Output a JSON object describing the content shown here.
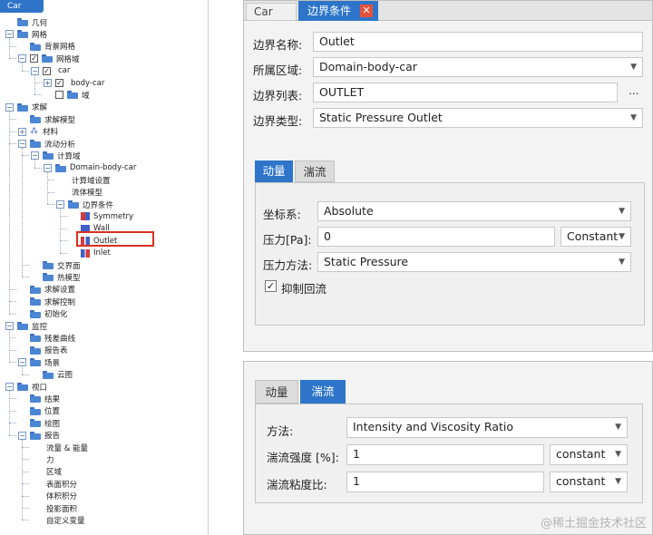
{
  "left_panel": {
    "tab_label": "Car",
    "tree": [
      {
        "label": "几何",
        "icon": "folder",
        "indent": 0,
        "expander": ""
      },
      {
        "label": "网格",
        "icon": "folder",
        "indent": 0,
        "expander": "−"
      },
      {
        "label": "背景网格",
        "icon": "folder",
        "indent": 1,
        "expander": ""
      },
      {
        "label": "网格域",
        "icon": "folder",
        "indent": 1,
        "expander": "−",
        "checked": "✓"
      },
      {
        "label": "car",
        "icon": "none",
        "indent": 2,
        "expander": "−",
        "checked": "✓"
      },
      {
        "label": "body-car",
        "icon": "none",
        "indent": 3,
        "expander": "+",
        "checked": "✓"
      },
      {
        "label": "域",
        "icon": "folder",
        "indent": 3,
        "expander": "",
        "checked": ""
      },
      {
        "label": "求解",
        "icon": "folder",
        "indent": 0,
        "expander": "−"
      },
      {
        "label": "求解模型",
        "icon": "folder",
        "indent": 1,
        "expander": ""
      },
      {
        "label": "材料",
        "icon": "material",
        "indent": 1,
        "expander": "+"
      },
      {
        "label": "流动分析",
        "icon": "folder",
        "indent": 1,
        "expander": "−"
      },
      {
        "label": "计算域",
        "icon": "folder",
        "indent": 2,
        "expander": "−"
      },
      {
        "label": "Domain-body-car",
        "icon": "folder",
        "indent": 3,
        "expander": "−"
      },
      {
        "label": "计算域设置",
        "icon": "none",
        "indent": 4,
        "expander": ""
      },
      {
        "label": "流体模型",
        "icon": "none",
        "indent": 4,
        "expander": ""
      },
      {
        "label": "边界条件",
        "icon": "folder",
        "indent": 4,
        "expander": "−"
      },
      {
        "label": "Symmetry",
        "icon": "boundary-sym",
        "indent": 5,
        "expander": ""
      },
      {
        "label": "Wall",
        "icon": "boundary-wall",
        "indent": 5,
        "expander": ""
      },
      {
        "label": "Outlet",
        "icon": "boundary-outlet",
        "indent": 5,
        "expander": ""
      },
      {
        "label": "Inlet",
        "icon": "boundary-inlet",
        "indent": 5,
        "expander": ""
      },
      {
        "label": "交界面",
        "icon": "folder",
        "indent": 2,
        "expander": ""
      },
      {
        "label": "热模型",
        "icon": "folder",
        "indent": 2,
        "expander": ""
      },
      {
        "label": "求解设置",
        "icon": "folder",
        "indent": 1,
        "expander": ""
      },
      {
        "label": "求解控制",
        "icon": "folder",
        "indent": 1,
        "expander": ""
      },
      {
        "label": "初始化",
        "icon": "folder",
        "indent": 1,
        "expander": ""
      },
      {
        "label": "监控",
        "icon": "folder",
        "indent": 0,
        "expander": "−"
      },
      {
        "label": "残差曲线",
        "icon": "folder",
        "indent": 1,
        "expander": ""
      },
      {
        "label": "报告表",
        "icon": "folder",
        "indent": 1,
        "expander": ""
      },
      {
        "label": "场景",
        "icon": "folder",
        "indent": 1,
        "expander": "−"
      },
      {
        "label": "云图",
        "icon": "folder",
        "indent": 2,
        "expander": ""
      },
      {
        "label": "视口",
        "icon": "folder",
        "indent": 0,
        "expander": "−"
      },
      {
        "label": "结果",
        "icon": "folder",
        "indent": 1,
        "expander": ""
      },
      {
        "label": "位置",
        "icon": "folder",
        "indent": 1,
        "expander": ""
      },
      {
        "label": "绘图",
        "icon": "folder",
        "indent": 1,
        "expander": ""
      },
      {
        "label": "报告",
        "icon": "folder",
        "indent": 1,
        "expander": "−"
      },
      {
        "label": "流量 & 能量",
        "icon": "none",
        "indent": 2,
        "expander": ""
      },
      {
        "label": "力",
        "icon": "none",
        "indent": 2,
        "expander": ""
      },
      {
        "label": "区域",
        "icon": "none",
        "indent": 2,
        "expander": ""
      },
      {
        "label": "表面积分",
        "icon": "none",
        "indent": 2,
        "expander": ""
      },
      {
        "label": "体积积分",
        "icon": "none",
        "indent": 2,
        "expander": ""
      },
      {
        "label": "投影面积",
        "icon": "none",
        "indent": 2,
        "expander": ""
      },
      {
        "label": "自定义变量",
        "icon": "none",
        "indent": 2,
        "expander": ""
      }
    ],
    "selected_item": "Outlet"
  },
  "top_panel": {
    "tab_car": "Car",
    "tab_active": "边界条件",
    "close_glyph": "✕",
    "fields": {
      "name_label": "边界名称:",
      "name_value": "Outlet",
      "region_label": "所属区域:",
      "region_value": "Domain-body-car",
      "list_label": "边界列表:",
      "list_value": "OUTLET",
      "list_button": "...",
      "type_label": "边界类型:",
      "type_value": "Static Pressure Outlet"
    },
    "subtabs": {
      "momentum": "动量",
      "turbulence": "湍流"
    },
    "momentum": {
      "coord_label": "坐标系:",
      "coord_value": "Absolute",
      "pressure_label": "压力[Pa]:",
      "pressure_value": "0",
      "pressure_mode": "Constant",
      "method_label": "压力方法:",
      "method_value": "Static Pressure",
      "backflow_checked": "✓",
      "backflow_label": "抑制回流"
    }
  },
  "bottom_panel": {
    "subtabs": {
      "momentum": "动量",
      "turbulence": "湍流"
    },
    "method_label": "方法:",
    "method_value": "Intensity and Viscosity Ratio",
    "intensity_label": "湍流强度 [%]:",
    "intensity_value": "1",
    "intensity_mode": "constant",
    "viscosity_label": "湍流粘度比:",
    "viscosity_value": "1",
    "viscosity_mode": "constant"
  },
  "watermark": "@稀土掘金技术社区",
  "icons": {
    "dropdown": "chevron-down-icon",
    "close": "close-icon"
  },
  "colors": {
    "accent": "#2e75c9",
    "close": "#e5513a",
    "highlight": "#d9301f"
  }
}
